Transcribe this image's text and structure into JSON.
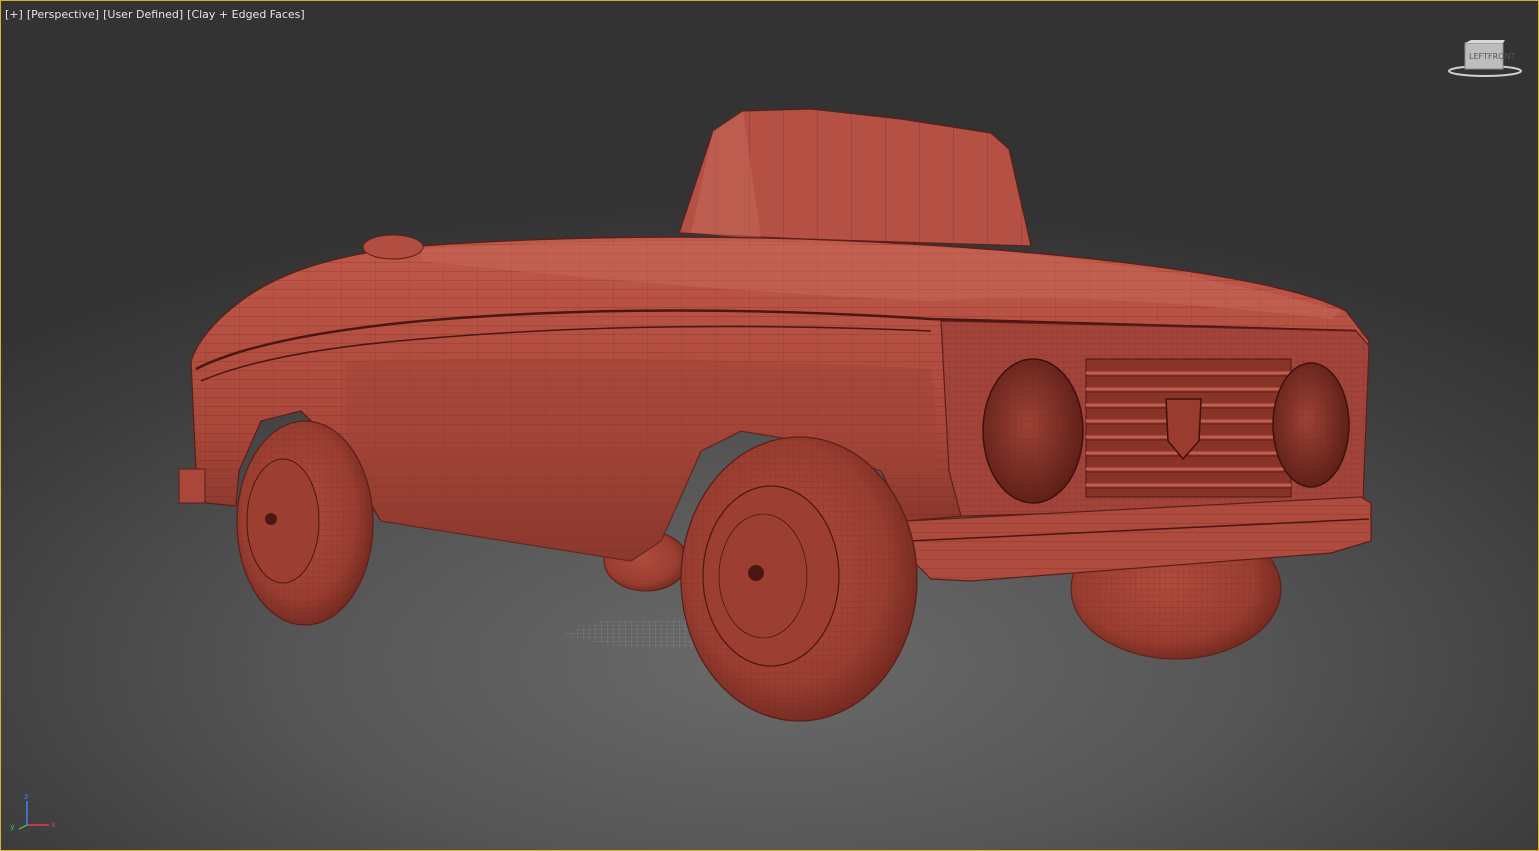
{
  "viewport": {
    "label": {
      "plus": "[+]",
      "view": "[Perspective]",
      "camera": "[User Defined]",
      "shading": "[Clay + Edged Faces]"
    },
    "active_border_color": "#d8b02a",
    "clay_color": "#b34b3c",
    "wire_color": "#5c1f18"
  },
  "viewcube": {
    "face_front": "FRONT",
    "face_left": "LEFT"
  },
  "axis": {
    "x": "x",
    "y": "y",
    "z": "z",
    "x_color": "#e04040",
    "y_color": "#40c040",
    "z_color": "#4080ff"
  }
}
